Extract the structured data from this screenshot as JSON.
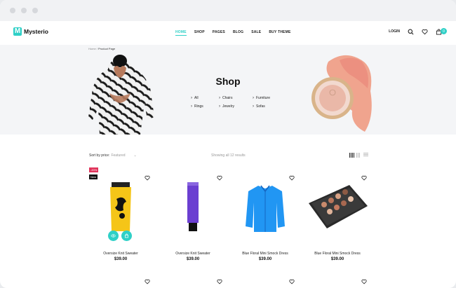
{
  "brand": {
    "logo_letter": "M",
    "name": "Mysterio",
    "accent": "#2fd0c7"
  },
  "nav": [
    {
      "label": "HOME",
      "active": true
    },
    {
      "label": "SHOP"
    },
    {
      "label": "PAGES"
    },
    {
      "label": "BLOG"
    },
    {
      "label": "SALE"
    },
    {
      "label": "BUY THEME"
    }
  ],
  "header": {
    "login_label": "LOGIN",
    "cart_count": "0"
  },
  "breadcrumb": {
    "home": "Home",
    "separator": " / ",
    "current": "Product Page"
  },
  "hero": {
    "title": "Shop",
    "categories": [
      "All",
      "Chairs",
      "Furniture",
      "Rings",
      "Jewelry",
      "Sofas"
    ]
  },
  "toolbar": {
    "sort_label": "Sort by price:",
    "sort_value": "Featured",
    "results_text": "Showing all 12 results"
  },
  "products": [
    {
      "name": "Oversize Knit Sweater",
      "price": "$39.00",
      "badges": [
        "-20%",
        "New"
      ]
    },
    {
      "name": "Oversize Knit Sweater",
      "price": "$39.00"
    },
    {
      "name": "Blue Floral Mini Smock Dress",
      "price": "$39.00"
    },
    {
      "name": "Blue Floral Mini Smock Dress",
      "price": "$39.00"
    }
  ],
  "icons": [
    "search-icon",
    "heart-icon",
    "cart-icon",
    "chevron-right-icon",
    "grid-view-icon",
    "list-view-icon",
    "eye-icon",
    "bag-icon"
  ]
}
